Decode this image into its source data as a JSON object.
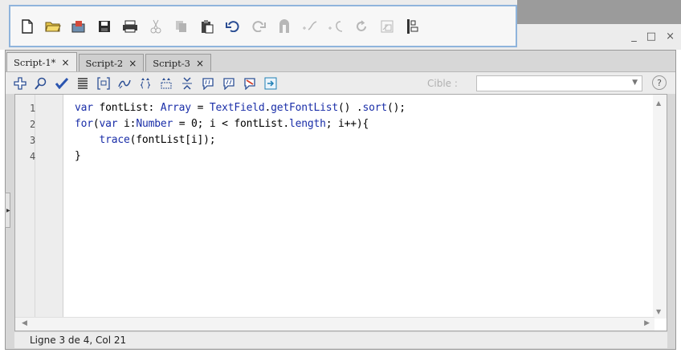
{
  "window": {
    "controls": {
      "minimize": "_",
      "maximize": "□",
      "close": "×"
    }
  },
  "main_toolbar": {
    "buttons": [
      {
        "icon": "new-file-icon",
        "glyph": "🗋"
      },
      {
        "icon": "open-folder-icon",
        "glyph": "📂"
      },
      {
        "icon": "import-icon",
        "glyph": "📥"
      },
      {
        "icon": "save-icon",
        "glyph": "💾"
      },
      {
        "icon": "print-icon",
        "glyph": "🖨"
      },
      {
        "icon": "cut-icon",
        "glyph": "✂"
      },
      {
        "icon": "copy-icon",
        "glyph": "📄"
      },
      {
        "icon": "paste-icon",
        "glyph": "📋"
      },
      {
        "icon": "undo-icon",
        "glyph": "↶"
      },
      {
        "icon": "redo-icon",
        "glyph": "↷"
      },
      {
        "icon": "snap-icon",
        "glyph": "⧉"
      },
      {
        "icon": "smooth-icon",
        "glyph": "⤳"
      },
      {
        "icon": "straighten-icon",
        "glyph": "⤶"
      },
      {
        "icon": "rotate-icon",
        "glyph": "↻"
      },
      {
        "icon": "scale-icon",
        "glyph": "▣"
      },
      {
        "icon": "align-icon",
        "glyph": "⊞"
      }
    ]
  },
  "tabs": [
    {
      "label": "Script-1*",
      "close": "×",
      "active": true
    },
    {
      "label": "Script-2",
      "close": "×",
      "active": false
    },
    {
      "label": "Script-3",
      "close": "×",
      "active": false
    }
  ],
  "action_toolbar": {
    "target_label": "Cible :",
    "target_value": "",
    "help": "?"
  },
  "editor": {
    "lines": [
      {
        "number": "1",
        "code": "var fontList: Array = TextField.getFontList() .sort();"
      },
      {
        "number": "2",
        "code": "for(var i:Number = 0; i < fontList.length; i++){"
      },
      {
        "number": "3",
        "code": "    trace(fontList[i]);"
      },
      {
        "number": "4",
        "code": "}"
      }
    ]
  },
  "status": {
    "text": "Ligne 3 de 4, Col 21"
  }
}
